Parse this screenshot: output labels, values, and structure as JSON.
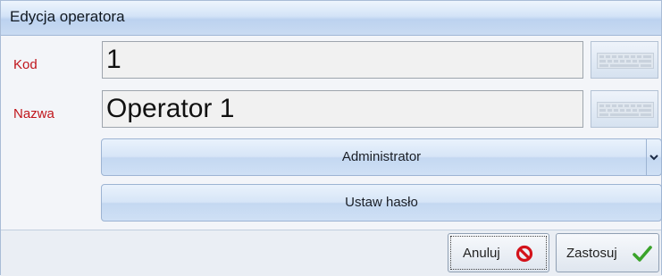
{
  "window": {
    "title": "Edycja operatora"
  },
  "form": {
    "code": {
      "label": "Kod",
      "value": "1"
    },
    "name": {
      "label": "Nazwa",
      "value": "Operator 1"
    },
    "role_select": {
      "selected": "Administrator"
    },
    "set_password_label": "Ustaw hasło"
  },
  "footer": {
    "cancel_label": "Anuluj",
    "apply_label": "Zastosuj"
  },
  "icons": {
    "keyboard": "keyboard-icon",
    "dropdown": "chevron-down-icon",
    "cancel": "prohibited-icon",
    "apply": "checkmark-icon"
  },
  "colors": {
    "label_red": "#c0151b",
    "cancel_red": "#d3121a",
    "check_green": "#3aa32a"
  }
}
